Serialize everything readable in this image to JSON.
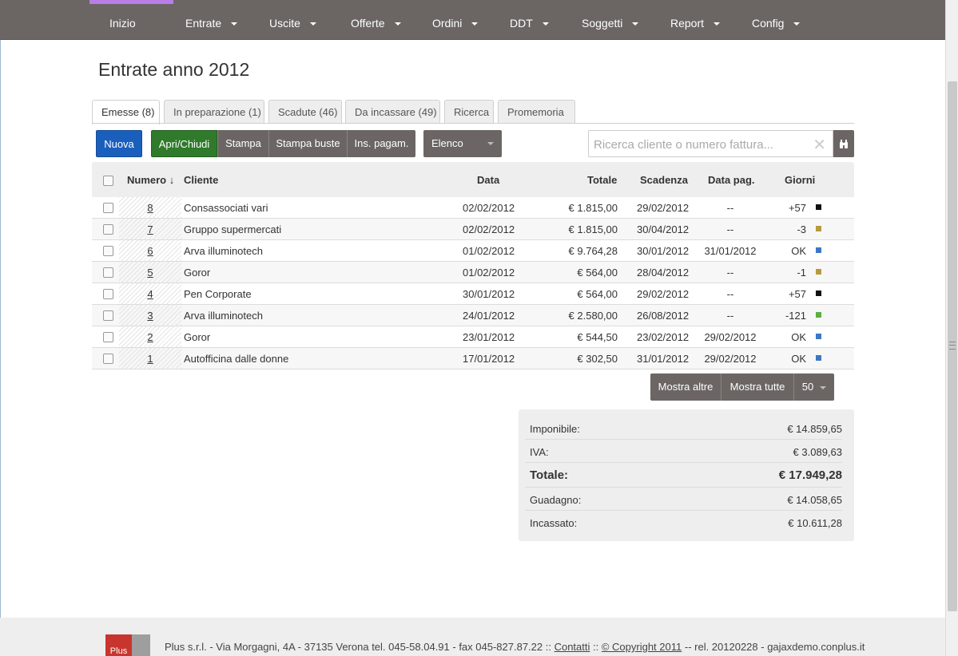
{
  "nav": {
    "items": [
      {
        "label": "Inizio",
        "caret": false
      },
      {
        "label": "Entrate",
        "caret": true
      },
      {
        "label": "Uscite",
        "caret": true
      },
      {
        "label": "Offerte",
        "caret": true
      },
      {
        "label": "Ordini",
        "caret": true
      },
      {
        "label": "DDT",
        "caret": true
      },
      {
        "label": "Soggetti",
        "caret": true
      },
      {
        "label": "Report",
        "caret": true
      },
      {
        "label": "Config",
        "caret": true
      }
    ]
  },
  "page_title": "Entrate anno 2012",
  "tabs": [
    {
      "label": "Emesse (8)",
      "active": true
    },
    {
      "label": "In preparazione (1)",
      "active": false
    },
    {
      "label": "Scadute (46)",
      "active": false
    },
    {
      "label": "Da incassare (49)",
      "active": false
    },
    {
      "label": "Ricerca",
      "active": false
    },
    {
      "label": "Promemoria",
      "active": false
    }
  ],
  "toolbar": {
    "nuova": "Nuova",
    "apri_chiudi": "Apri/Chiudi",
    "stampa": "Stampa",
    "stampa_buste": "Stampa buste",
    "ins_pagam": "Ins. pagam.",
    "view_select": "Elenco"
  },
  "search": {
    "placeholder": "Ricerca cliente o numero fattura...",
    "value": "",
    "clear": "✕"
  },
  "table": {
    "headers": {
      "numero": "Numero ↓",
      "cliente": "Cliente",
      "data": "Data",
      "totale": "Totale",
      "scadenza": "Scadenza",
      "data_pag": "Data pag.",
      "giorni": "Giorni"
    },
    "rows": [
      {
        "numero": "8",
        "cliente": "Consassociati vari",
        "data": "02/02/2012",
        "totale": "€ 1.815,00",
        "scadenza": "29/02/2012",
        "data_pag": "--",
        "giorni": "+57",
        "color": "#111111"
      },
      {
        "numero": "7",
        "cliente": "Gruppo supermercati",
        "data": "02/02/2012",
        "totale": "€ 1.815,00",
        "scadenza": "30/04/2012",
        "data_pag": "--",
        "giorni": "-3",
        "color": "#b89a3e"
      },
      {
        "numero": "6",
        "cliente": "Arva illuminotech",
        "data": "01/02/2012",
        "totale": "€ 9.764,28",
        "scadenza": "30/01/2012",
        "data_pag": "31/01/2012",
        "giorni": "OK",
        "color": "#3b78c4"
      },
      {
        "numero": "5",
        "cliente": "Goror",
        "data": "01/02/2012",
        "totale": "€ 564,00",
        "scadenza": "28/04/2012",
        "data_pag": "--",
        "giorni": "-1",
        "color": "#b89a3e"
      },
      {
        "numero": "4",
        "cliente": "Pen Corporate",
        "data": "30/01/2012",
        "totale": "€ 564,00",
        "scadenza": "29/02/2012",
        "data_pag": "--",
        "giorni": "+57",
        "color": "#111111"
      },
      {
        "numero": "3",
        "cliente": "Arva illuminotech",
        "data": "24/01/2012",
        "totale": "€ 2.580,00",
        "scadenza": "26/08/2012",
        "data_pag": "--",
        "giorni": "-121",
        "color": "#5bb040"
      },
      {
        "numero": "2",
        "cliente": "Goror",
        "data": "23/01/2012",
        "totale": "€ 544,50",
        "scadenza": "23/02/2012",
        "data_pag": "29/02/2012",
        "giorni": "OK",
        "color": "#3b78c4"
      },
      {
        "numero": "1",
        "cliente": "Autofficina dalle donne",
        "data": "17/01/2012",
        "totale": "€ 302,50",
        "scadenza": "31/01/2012",
        "data_pag": "29/02/2012",
        "giorni": "OK",
        "color": "#3b78c4"
      }
    ]
  },
  "pager": {
    "mostra_altre": "Mostra altre",
    "mostra_tutte": "Mostra tutte",
    "page_size": "50"
  },
  "totals": [
    {
      "label": "Imponibile:",
      "value": "€ 14.859,65",
      "big": false
    },
    {
      "label": "IVA:",
      "value": "€ 3.089,63",
      "big": false
    },
    {
      "label": "Totale:",
      "value": "€ 17.949,28",
      "big": true
    },
    {
      "label": "Guadagno:",
      "value": "€ 14.058,65",
      "big": false
    },
    {
      "label": "Incassato:",
      "value": "€ 10.611,28",
      "big": false
    }
  ],
  "footer": {
    "logo_text": "Plus",
    "address": "Plus s.r.l. - Via Morgagni, 4A - 37135 Verona tel. 045-58.04.91 - fax 045-827.87.22 :: ",
    "contatti": "Contatti",
    "sep": " :: ",
    "copyright": "© Copyright 2011",
    "release": " -- rel. 20120228 - gajaxdemo.conplus.it"
  },
  "colors": {
    "topbar": "#6b6664",
    "primary_blue": "#1b5fbd",
    "green": "#2f7a2b",
    "logo_purple": "#b97ee6",
    "footer_red": "#c8352e"
  }
}
